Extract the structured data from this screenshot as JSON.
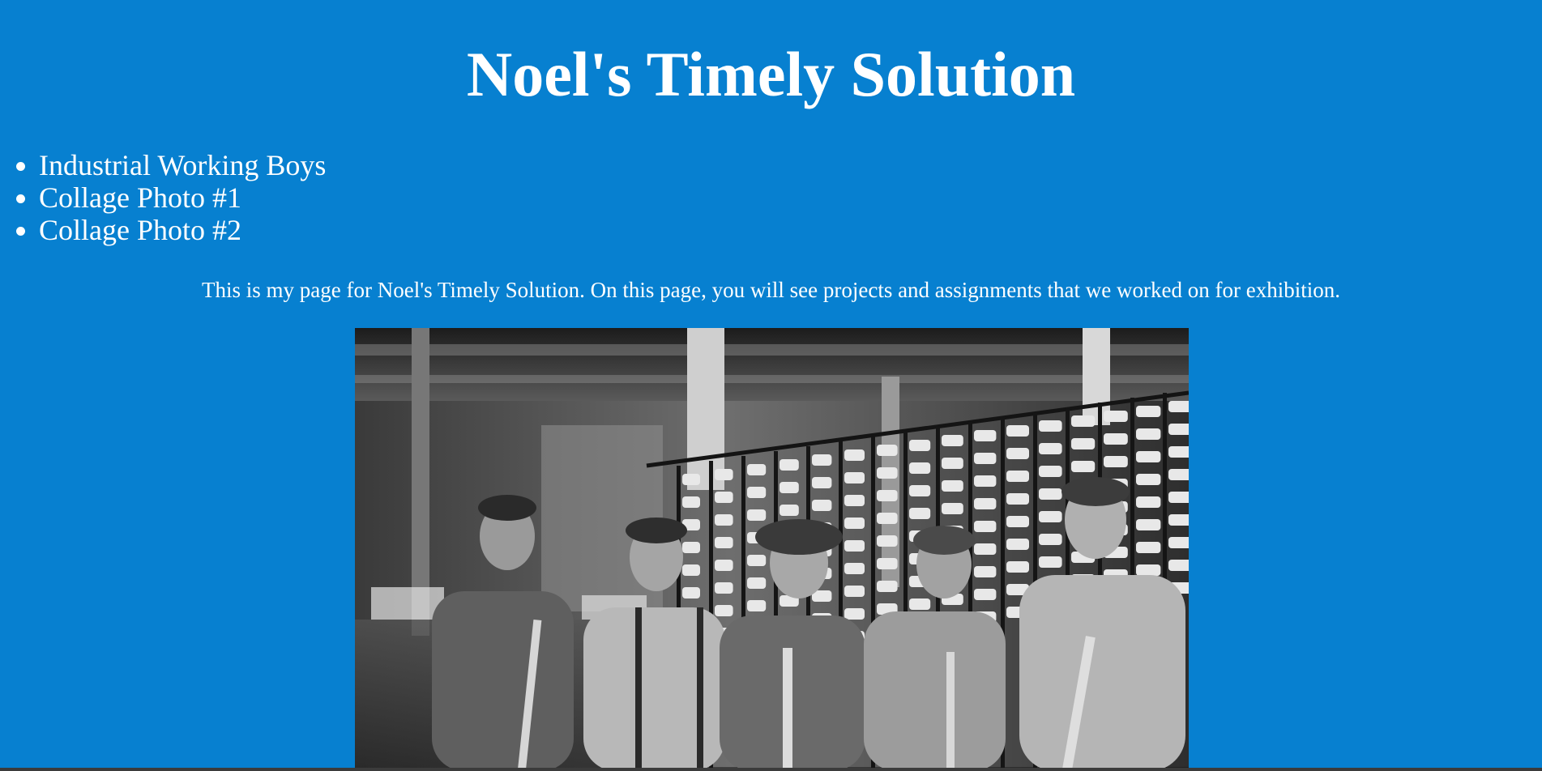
{
  "page": {
    "title": "Noel's Timely Solution",
    "nav_items": [
      "Industrial Working Boys",
      "Collage Photo #1",
      "Collage Photo #2"
    ],
    "intro": "This is my page for Noel's Timely Solution. On this page, you will see projects and assignments that we worked on for exhibition."
  },
  "colors": {
    "background": "#0780d0",
    "text": "#ffffff"
  }
}
